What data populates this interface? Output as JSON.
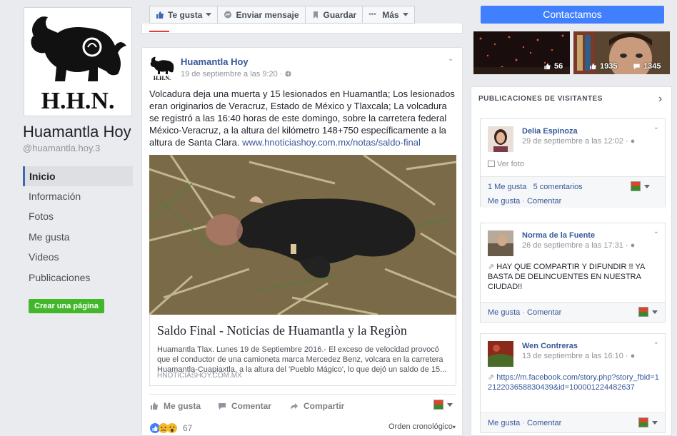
{
  "page": {
    "name": "Huamantla Hoy",
    "handle": "@huamantla.hoy.3",
    "logo_text": "H.H.N."
  },
  "nav": {
    "items": [
      {
        "label": "Inicio"
      },
      {
        "label": "Información"
      },
      {
        "label": "Fotos"
      },
      {
        "label": "Me gusta"
      },
      {
        "label": "Videos"
      },
      {
        "label": "Publicaciones"
      }
    ],
    "create_page": "Crear una página"
  },
  "toolbar": {
    "like": "Te gusta",
    "message": "Enviar mensaje",
    "save": "Guardar",
    "more": "Más"
  },
  "contact_button": "Contactamos",
  "thumbnails": [
    {
      "count": "56"
    },
    {
      "count": "1935",
      "count2": "1345"
    }
  ],
  "post": {
    "author": "Huamantla Hoy",
    "time": "19 de septiembre a las 9:20 · ",
    "text": "Volcadura deja una muerta y 15 lesionados en Huamantla; Los lesionados eran originarios de Veracruz, Estado de México y Tlaxcala; La volcadura se registró a las 16:40 horas de este domingo, sobre la carretera federal México-Veracruz, a la altura del kilómetro 148+750 específicamente a la altura de Santa Clara. ",
    "link_inline": "www.hnoticiashoy.com.mx/notas/saldo-final",
    "link_title": "Saldo Final - Noticias de Huamantla y la Regiòn",
    "link_desc": "Huamantla Tlax. Lunes 19 de Septiembre 2016.- El exceso de velocidad provocó que el conductor de una camioneta marca Mercedez Benz, volcara en la carretera Huamantla-Cuapiaxtla, a la altura del 'Pueblo Mágico', lo que dejó un saldo de 15...",
    "link_domain": "HNOTICIASHOY.COM.MX",
    "actions": {
      "like": "Me gusta",
      "comment": "Comentar",
      "share": "Compartir"
    },
    "reactions_count": "67",
    "order": "Orden cronológico"
  },
  "visitors": {
    "header": "PUBLICACIONES DE VISITANTES",
    "posts": [
      {
        "name": "Delia Espinoza",
        "time": "29 de septiembre a las 12:02 · ",
        "body": "Ver foto",
        "stats_likes": "1 Me gusta",
        "stats_comments": "5 comentarios",
        "like": "Me gusta",
        "comment": "Comentar"
      },
      {
        "name": "Norma de la Fuente",
        "time": "26 de septiembre a las 17:31 · ",
        "body": "HAY QUE COMPARTIR Y DIFUNDIR !! YA BASTA DE DELINCUENTES EN NUESTRA CIUDAD!!",
        "like": "Me gusta",
        "comment": "Comentar"
      },
      {
        "name": "Wen Contreras",
        "time": "13 de septiembre a las 16:10 · ",
        "body": "https://m.facebook.com/story.php?story_fbid=1212203658830439&id=100001224482637",
        "like": "Me gusta",
        "comment": "Comentar"
      }
    ]
  }
}
